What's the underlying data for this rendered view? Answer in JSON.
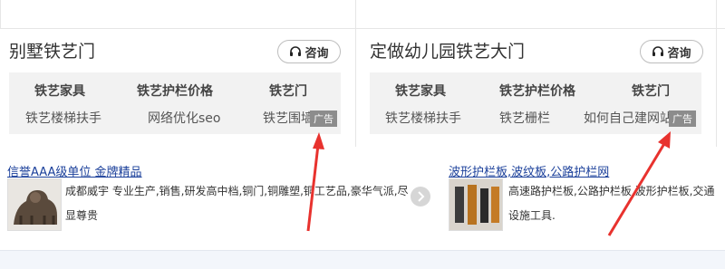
{
  "panels": [
    {
      "title": "别墅铁艺门",
      "consult_label": "咨询",
      "tags_row1": [
        "铁艺家具",
        "铁艺护栏价格",
        "铁艺门"
      ],
      "tags_row2": [
        "铁艺楼梯扶手",
        "网络优化seo",
        "铁艺围墙"
      ],
      "ad_badge": "广告"
    },
    {
      "title": "定做幼儿园铁艺大门",
      "consult_label": "咨询",
      "tags_row1": [
        "铁艺家具",
        "铁艺护栏价格",
        "铁艺门"
      ],
      "tags_row2": [
        "铁艺楼梯扶手",
        "铁艺栅栏",
        "如何自己建网站"
      ],
      "ad_badge": "广告"
    }
  ],
  "ads": [
    {
      "title": "信誉AAA级单位 金牌精品",
      "desc": "成都威宇 专业生产,销售,研发高中档,铜门,铜雕塑,铜工艺品,豪华气派,尽显尊贵"
    },
    {
      "title": "波形护栏板,波纹板,公路护栏网",
      "desc": "高速路护栏板,公路护栏板,波形护栏板,交通设施工具."
    }
  ],
  "colors": {
    "link": "#1a3f9a",
    "arrow": "#e8322e",
    "tag_bg": "#f2f2f2",
    "badge_bg": "#8c8c8c"
  },
  "icons": {
    "consult": "headset-icon",
    "next": "chevron-right-icon"
  }
}
